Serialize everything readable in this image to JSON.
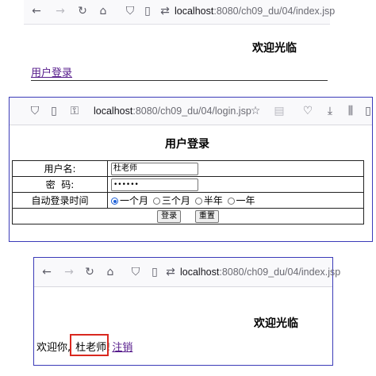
{
  "colors": {
    "frame_border": "#3b3bb8",
    "link": "#551a8b",
    "highlight": "#d9281f",
    "radio_selected": "#2062d8"
  },
  "window1": {
    "url_host": "localhost",
    "url_path": ":8080/ch09_du/04/index.jsp",
    "title": "欢迎光临",
    "login_link": "用户登录"
  },
  "window2": {
    "url_host": "localhost",
    "url_path": ":8080/ch09_du/04/login.jsp",
    "title": "用户登录",
    "username_label": "用户名:",
    "username_value": "杜老师",
    "password_label": "密  码:",
    "password_value": "••••••",
    "autologin_label": "自动登录时间",
    "options": [
      "一个月",
      "三个月",
      "半年",
      "一年"
    ],
    "submit_label": "登录",
    "reset_label": "重置"
  },
  "window3": {
    "url_host": "localhost",
    "url_path": ":8080/ch09_du/04/index.jsp",
    "title": "欢迎光临",
    "welcome_prefix": "欢迎你,",
    "username": "杜老师!",
    "logout_link": "注销"
  }
}
